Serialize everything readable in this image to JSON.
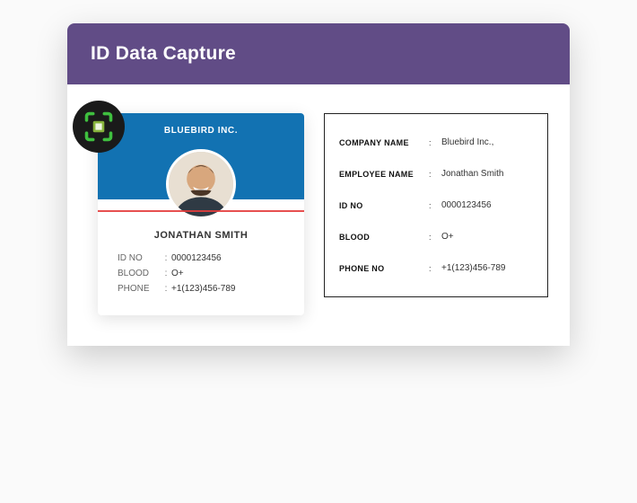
{
  "header": {
    "title": "ID Data Capture"
  },
  "card": {
    "company": "BLUEBIRD INC.",
    "employee_name": "JONATHAN SMITH",
    "fields": {
      "id_no": {
        "label": "ID NO",
        "value": "0000123456"
      },
      "blood": {
        "label": "BLOOD",
        "value": "O+"
      },
      "phone": {
        "label": "PHONE",
        "value": "+1(123)456-789"
      }
    }
  },
  "output": {
    "company_name": {
      "label": "COMPANY NAME",
      "value": "Bluebird Inc.,"
    },
    "employee_name": {
      "label": "EMPLOYEE NAME",
      "value": "Jonathan Smith"
    },
    "id_no": {
      "label": "ID NO",
      "value": "0000123456"
    },
    "blood": {
      "label": "BLOOD",
      "value": "O+"
    },
    "phone_no": {
      "label": "PHONE NO",
      "value": "+1(123)456-789"
    }
  },
  "colors": {
    "header_bg": "#614c86",
    "card_top": "#1272b2",
    "scan_line": "#e43d3d"
  }
}
